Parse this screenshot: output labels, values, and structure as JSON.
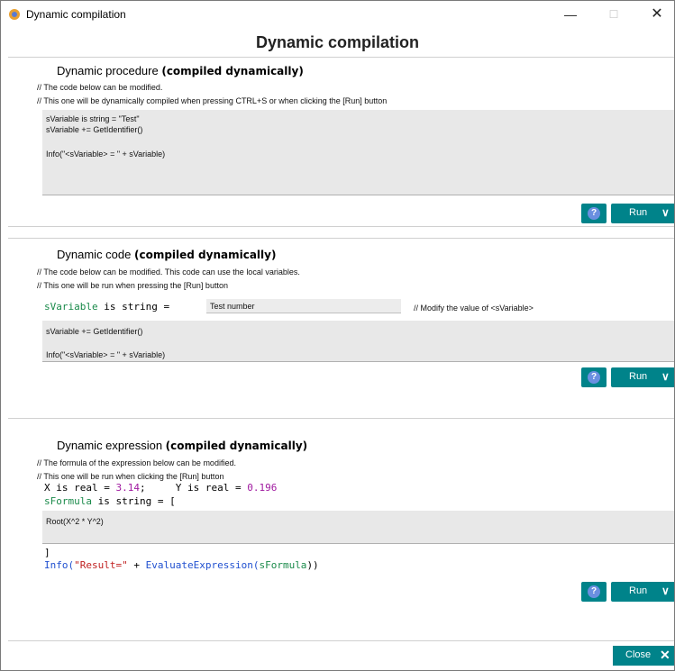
{
  "window": {
    "title": "Dynamic compilation",
    "minimize": "—",
    "maximize": "☐",
    "close": "✕"
  },
  "page": {
    "title": "Dynamic compilation"
  },
  "section1": {
    "title_plain": "Dynamic procedure ",
    "title_bold": "(compiled dynamically)",
    "comment1": "// The code below can be modified.",
    "comment2": "// This one will be dynamically compiled when pressing CTRL+S or when clicking the [Run] button",
    "code1": "sVariable is string = \"Test\"",
    "code2": "sVariable += GetIdentifier()",
    "code3": "Info(\"<sVariable> = \" + sVariable)",
    "run_label": "Run"
  },
  "section2": {
    "title_plain": "Dynamic code ",
    "title_bold": "(compiled dynamically)",
    "comment1": "// The code below can be modified. This code can use the local variables.",
    "comment2": "// This one will be run when pressing the [Run] button",
    "decl_var": "sVariable",
    "decl_rest": " is string = ",
    "input_value": "Test number",
    "input_comment": "// Modify the value of <sVariable>",
    "code1": "sVariable += GetIdentifier()",
    "code2": "Info(\"<sVariable> = \" + sVariable)",
    "run_label": "Run"
  },
  "section3": {
    "title_plain": "Dynamic expression ",
    "title_bold": "(compiled dynamically)",
    "comment1": "// The formula of the expression below can be modified.",
    "comment2": "// This one will be run when clicking the [Run] button",
    "x_decl": "X is real = ",
    "x_val": "3.14",
    "x_end": ";",
    "y_decl": "Y is real = ",
    "y_val": "0.196",
    "formula_var": "sFormula",
    "formula_rest": " is string = [",
    "formula": "Root(X^2 * Y^2)",
    "close_bracket": "]",
    "info_fn": "Info(",
    "info_str": "\"Result=\"",
    "info_plus": " + ",
    "info_eval": "EvaluateExpression(",
    "info_arg": "sFormula",
    "info_end": "))",
    "run_label": "Run"
  },
  "footer": {
    "close_label": "Close"
  },
  "colors": {
    "accent": "#00838a",
    "code_bg": "#e8e8e8"
  }
}
